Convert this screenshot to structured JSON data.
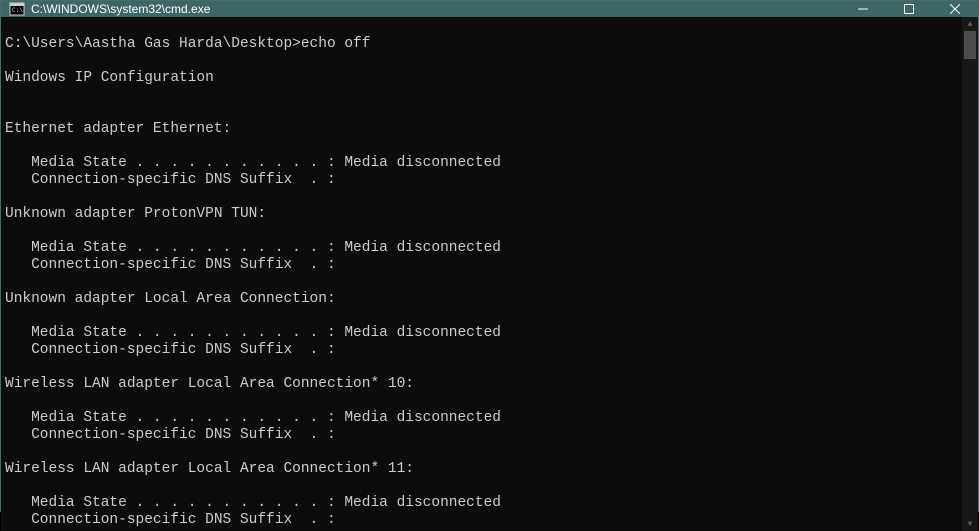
{
  "window": {
    "title": "C:\\WINDOWS\\system32\\cmd.exe"
  },
  "terminal": {
    "lines": [
      "",
      "C:\\Users\\Aastha Gas Harda\\Desktop>echo off",
      "",
      "Windows IP Configuration",
      "",
      "",
      "Ethernet adapter Ethernet:",
      "",
      "   Media State . . . . . . . . . . . : Media disconnected",
      "   Connection-specific DNS Suffix  . :",
      "",
      "Unknown adapter ProtonVPN TUN:",
      "",
      "   Media State . . . . . . . . . . . : Media disconnected",
      "   Connection-specific DNS Suffix  . :",
      "",
      "Unknown adapter Local Area Connection:",
      "",
      "   Media State . . . . . . . . . . . : Media disconnected",
      "   Connection-specific DNS Suffix  . :",
      "",
      "Wireless LAN adapter Local Area Connection* 10:",
      "",
      "   Media State . . . . . . . . . . . : Media disconnected",
      "   Connection-specific DNS Suffix  . :",
      "",
      "Wireless LAN adapter Local Area Connection* 11:",
      "",
      "   Media State . . . . . . . . . . . : Media disconnected",
      "   Connection-specific DNS Suffix  . :"
    ]
  }
}
